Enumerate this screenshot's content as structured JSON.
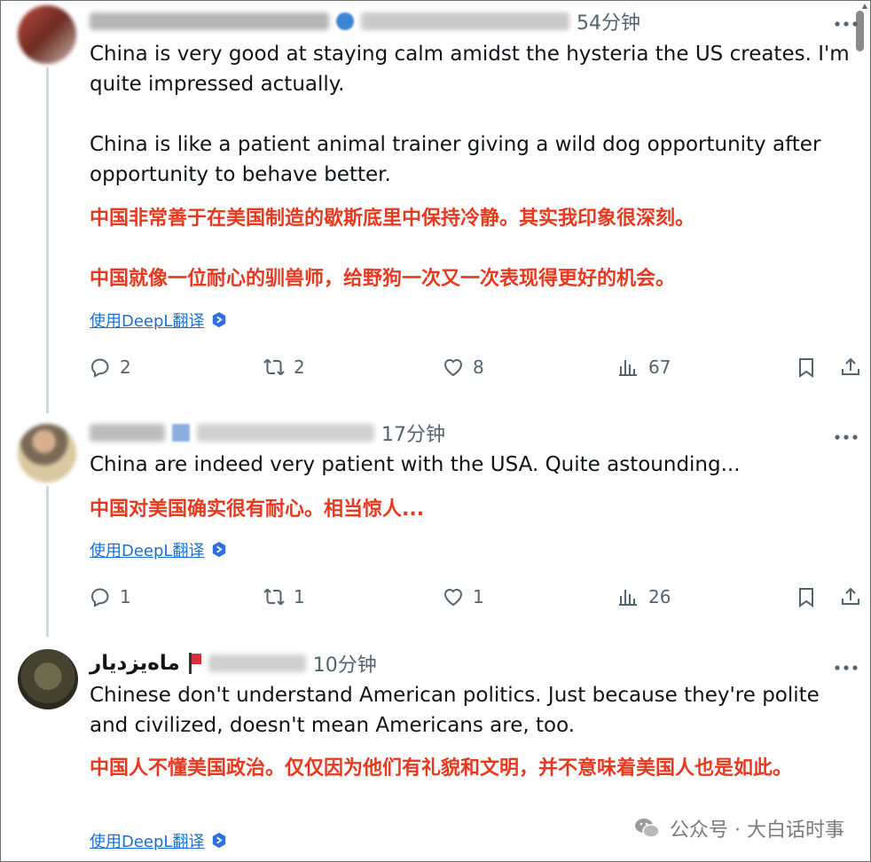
{
  "colors": {
    "text": "#0f1419",
    "muted": "#536471",
    "translation": "#e8391f",
    "link": "#1d6fd1"
  },
  "tweets": [
    {
      "time": "54分钟",
      "handle_visible": "@Sh··· g···nibl··wen",
      "english": "China is very good at staying calm amidst the hysteria the US creates. I'm quite impressed actually.\n\nChina is like a patient animal trainer giving a wild dog opportunity after opportunity to behave better.",
      "chinese": "中国非常善于在美国制造的歇斯底里中保持冷静。其实我印象很深刻。\n\n中国就像一位耐心的驯兽师，给野狗一次又一次表现得更好的机会。",
      "translate_label": "使用DeepL翻译",
      "replies": "2",
      "reposts": "2",
      "likes": "8",
      "views": "67"
    },
    {
      "time": "17分钟",
      "handle_visible": "@BarrettYouTube",
      "english": "China are indeed very patient with the USA. Quite astounding...",
      "chinese": "中国对美国确实很有耐心。相当惊人...",
      "translate_label": "使用DeepL翻译",
      "replies": "1",
      "reposts": "1",
      "likes": "1",
      "views": "26"
    },
    {
      "display_name": "ماه‌یزدیار",
      "handle_visible": "@···47Mil",
      "time": "10分钟",
      "english": "Chinese don't understand American politics. Just because they're polite and civilized, doesn't mean Americans are, too.",
      "chinese": "中国人不懂美国政治。仅仅因为他们有礼貌和文明，并不意味着美国人也是如此。",
      "translate_label": "使用DeepL翻译"
    }
  ],
  "watermark": {
    "text": "公众号 · 大白话时事"
  },
  "icons": [
    "reply-icon",
    "repost-icon",
    "like-icon",
    "views-icon",
    "bookmark-icon",
    "share-icon",
    "more-icon",
    "deepl-icon",
    "wechat-icon"
  ]
}
